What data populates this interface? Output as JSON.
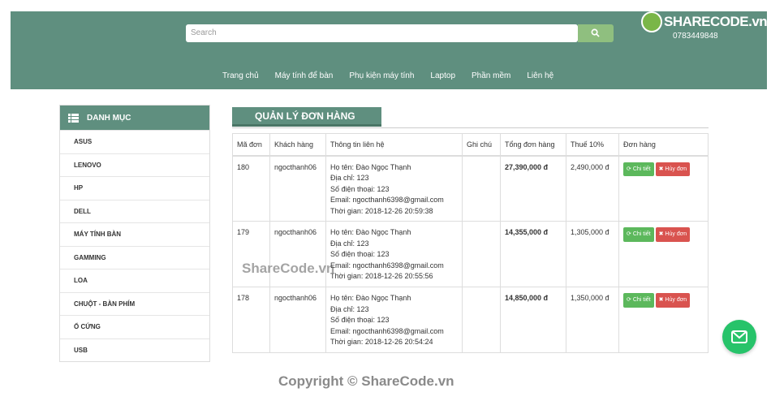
{
  "header": {
    "search_placeholder": "Search",
    "logo_text": "SHARECODE.vn",
    "phone": "0783449848",
    "nav": [
      "Trang chủ",
      "Máy tính để bàn",
      "Phụ kiện máy tính",
      "Laptop",
      "Phần mềm",
      "Liên hệ"
    ]
  },
  "sidebar": {
    "title": "DANH MỤC",
    "items": [
      "ASUS",
      "LENOVO",
      "HP",
      "DELL",
      "MÁY TÍNH BÀN",
      "GAMMING",
      "LOA",
      "CHUỘT - BÀN PHÍM",
      "Ổ CỨNG",
      "USB"
    ]
  },
  "main": {
    "title": "QUẢN LÝ ĐƠN HÀNG",
    "columns": [
      "Mã đơn",
      "Khách hàng",
      "Thông tin liên hệ",
      "Ghi chú",
      "Tổng đơn hàng",
      "Thuế 10%",
      "Đơn hàng"
    ],
    "detail_label": "Chi tiết",
    "cancel_label": "Hủy đơn",
    "rows": [
      {
        "id": "180",
        "customer": "ngocthanh06",
        "name": "Họ tên: Đào Ngọc Thạnh",
        "address": "Địa chỉ: 123",
        "phone": "Số điện thoại: 123",
        "email": "Email: ngocthanh6398@gmail.com",
        "time": "Thời gian: 2018-12-26 20:59:38",
        "note": "",
        "total": "27,390,000 đ",
        "tax": "2,490,000 đ"
      },
      {
        "id": "179",
        "customer": "ngocthanh06",
        "name": "Họ tên: Đào Ngọc Thạnh",
        "address": "Địa chỉ: 123",
        "phone": "Số điện thoại: 123",
        "email": "Email: ngocthanh6398@gmail.com",
        "time": "Thời gian: 2018-12-26 20:55:56",
        "note": "",
        "total": "14,355,000 đ",
        "tax": "1,305,000 đ"
      },
      {
        "id": "178",
        "customer": "ngocthanh06",
        "name": "Họ tên: Đào Ngọc Thạnh",
        "address": "Địa chỉ: 123",
        "phone": "Số điện thoại: 123",
        "email": "Email: ngocthanh6398@gmail.com",
        "time": "Thời gian: 2018-12-26 20:54:24",
        "note": "",
        "total": "14,850,000 đ",
        "tax": "1,350,000 đ"
      }
    ]
  },
  "watermark": "ShareCode.vn",
  "copyright": "Copyright © ShareCode.vn",
  "colors": {
    "header": "#5f8f7f",
    "accent_green": "#5cb85c",
    "danger": "#d9534f",
    "mail": "#27c36a"
  }
}
